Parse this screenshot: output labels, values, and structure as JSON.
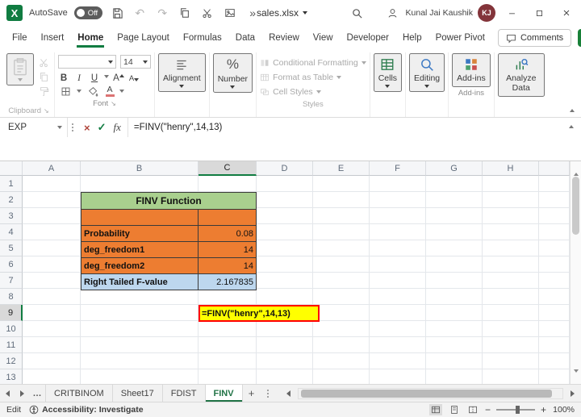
{
  "colors": {
    "accent_green": "#107C41",
    "table_header_green": "#A9D08E",
    "table_orange": "#ED7D31",
    "table_blue": "#BDD7EE",
    "highlight_yellow": "#FFFF00",
    "highlight_border_red": "#FF0000",
    "avatar_maroon": "#83343A"
  },
  "icons": {
    "logo_letter": "X",
    "undo": "↶",
    "redo": "↷",
    "more_chevrons": "»",
    "cancel": "×",
    "check": "✓",
    "fx": "fx",
    "percent": "%",
    "ellipsis": "…",
    "plus": "+",
    "minus": "−",
    "launcher": "↘",
    "letter_a": "A"
  },
  "titlebar": {
    "autosave_label": "AutoSave",
    "autosave_state": "Off",
    "filename": "sales.xlsx",
    "user_name": "Kunal Jai Kaushik",
    "user_initials": "KJ"
  },
  "menubar": {
    "items": [
      "File",
      "Insert",
      "Home",
      "Page Layout",
      "Formulas",
      "Data",
      "Review",
      "View",
      "Developer",
      "Help",
      "Power Pivot"
    ],
    "active_item": "Home",
    "comments_label": "Comments"
  },
  "ribbon": {
    "clipboard_group": "Clipboard",
    "font_group": "Font",
    "font_size": "14",
    "bold": "B",
    "italic": "I",
    "underline": "U",
    "alignment": "Alignment",
    "number": "Number",
    "conditional_formatting": "Conditional Formatting",
    "format_as_table": "Format as Table",
    "cell_styles": "Cell Styles",
    "styles_group": "Styles",
    "cells": "Cells",
    "editing": "Editing",
    "addins": "Add-ins",
    "addins_group": "Add-ins",
    "analyze_data": "Analyze Data"
  },
  "formula_bar": {
    "name_box": "EXP",
    "formula": "=FINV(\"henry\",14,13)"
  },
  "grid": {
    "column_headers": [
      "A",
      "B",
      "C",
      "D",
      "E",
      "F",
      "G",
      "H"
    ],
    "row_headers": [
      "1",
      "2",
      "3",
      "4",
      "5",
      "6",
      "7",
      "8",
      "9",
      "10",
      "11",
      "12",
      "13"
    ],
    "active_column": "C",
    "active_row": "9",
    "table": {
      "title": "FINV Function",
      "rows": [
        {
          "label": "Probability",
          "value": "0.08"
        },
        {
          "label": "deg_freedom1",
          "value": "14"
        },
        {
          "label": "deg_freedom2",
          "value": "14"
        },
        {
          "label": "Right Tailed F-value",
          "value": "2.167835"
        }
      ]
    },
    "formula_cell_text": "=FINV(\"henry\",14,13)"
  },
  "sheet_tabs": {
    "tabs": [
      "CRITBINOM",
      "Sheet17",
      "FDIST",
      "FINV"
    ],
    "active_tab": "FINV"
  },
  "status_bar": {
    "mode": "Edit",
    "accessibility": "Accessibility: Investigate",
    "zoom_level": "100%"
  }
}
